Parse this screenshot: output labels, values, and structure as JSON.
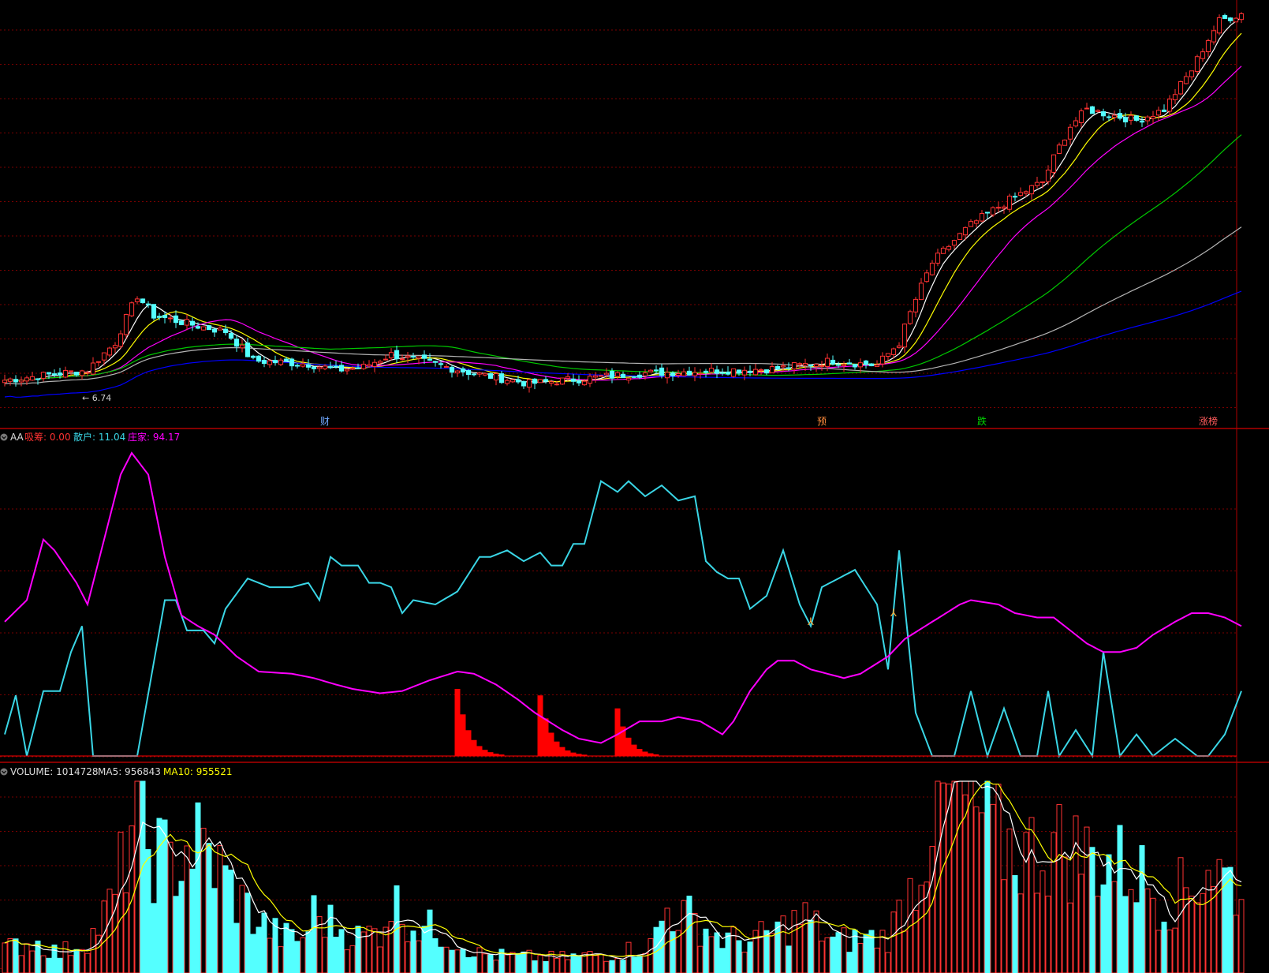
{
  "colors": {
    "background": "#000000",
    "grid": "#7a0000",
    "separator": "#b00000",
    "up": "#ff3232",
    "down": "#54ffff",
    "ma_white": "#ffffff",
    "ma_yellow": "#ffff00",
    "ma_magenta": "#ff00ff",
    "ma_green": "#00c800",
    "ma_gray": "#b4b4b4",
    "ma_blue": "#0000ff",
    "ind_cyan": "#3ad6e6",
    "ind_magenta": "#ff00ff",
    "ind_red": "#ff0000",
    "marker": "#ffaa33"
  },
  "price_panel": {
    "low_label": "6.74",
    "event_labels": [
      {
        "text": "财",
        "index": 58,
        "color": "#6fa8ff"
      },
      {
        "text": "预",
        "index": 148,
        "color": "#ff8c3c"
      },
      {
        "text": "跌",
        "index": 177,
        "color": "#00d200"
      },
      {
        "text": "涨榜",
        "index": 218,
        "color": "#ff5c5c"
      }
    ]
  },
  "indicator_panel": {
    "icon": "circle-chevron-icon",
    "name": "AA",
    "items": [
      {
        "label": "吸筹: 0.00",
        "color": "#ff3232"
      },
      {
        "label": "散户: 11.04",
        "color": "#3ad6e6"
      },
      {
        "label": "庄家: 94.17",
        "color": "#ff00ff"
      }
    ],
    "markers": [
      {
        "index": 146,
        "value": 62
      },
      {
        "index": 161,
        "value": 66
      }
    ]
  },
  "volume_panel": {
    "icon": "circle-chevron-icon",
    "items": [
      {
        "label": "VOLUME: 1014728",
        "color": "#dcdcdc"
      },
      {
        "label": "MA5: 956843",
        "color": "#dcdcdc"
      },
      {
        "label": "MA10: 955521",
        "color": "#ffff00"
      }
    ]
  },
  "chart_data": [
    {
      "type": "candlestick",
      "count": 225,
      "candle_keypoints": [
        [
          0,
          7.0
        ],
        [
          15,
          7.3
        ],
        [
          20,
          8.2
        ],
        [
          24,
          10.0
        ],
        [
          27,
          9.2
        ],
        [
          35,
          8.8
        ],
        [
          40,
          8.6
        ],
        [
          45,
          7.6
        ],
        [
          55,
          7.5
        ],
        [
          60,
          7.3
        ],
        [
          65,
          7.4
        ],
        [
          70,
          7.8
        ],
        [
          75,
          7.6
        ],
        [
          85,
          7.2
        ],
        [
          95,
          6.9
        ],
        [
          105,
          7.05
        ],
        [
          115,
          7.2
        ],
        [
          130,
          7.3
        ],
        [
          140,
          7.35
        ],
        [
          150,
          7.6
        ],
        [
          158,
          7.45
        ],
        [
          162,
          8.2
        ],
        [
          168,
          11.5
        ],
        [
          175,
          13.5
        ],
        [
          182,
          15.0
        ],
        [
          188,
          16.2
        ],
        [
          193,
          20.5
        ],
        [
          196,
          22.0
        ],
        [
          205,
          21.0
        ],
        [
          210,
          22.0
        ],
        [
          215,
          26.0
        ],
        [
          220,
          32.0
        ],
        [
          224,
          33.0
        ]
      ],
      "ma_windows": [
        5,
        10,
        20,
        60,
        120,
        250
      ]
    },
    {
      "type": "line",
      "series": [
        {
          "name": "散户",
          "keypoints": [
            [
              0,
              10
            ],
            [
              2,
              28
            ],
            [
              4,
              0
            ],
            [
              7,
              30
            ],
            [
              10,
              30
            ],
            [
              12,
              48
            ],
            [
              14,
              60
            ],
            [
              16,
              0
            ],
            [
              24,
              0
            ],
            [
              29,
              72
            ],
            [
              31,
              72
            ],
            [
              33,
              58
            ],
            [
              36,
              58
            ],
            [
              38,
              52
            ],
            [
              40,
              68
            ],
            [
              44,
              82
            ],
            [
              48,
              78
            ],
            [
              52,
              78
            ],
            [
              55,
              80
            ],
            [
              57,
              72
            ],
            [
              59,
              92
            ],
            [
              61,
              88
            ],
            [
              64,
              88
            ],
            [
              66,
              80
            ],
            [
              68,
              80
            ],
            [
              70,
              78
            ],
            [
              72,
              66
            ],
            [
              74,
              72
            ],
            [
              78,
              70
            ],
            [
              82,
              76
            ],
            [
              86,
              92
            ],
            [
              88,
              92
            ],
            [
              91,
              95
            ],
            [
              94,
              90
            ],
            [
              97,
              94
            ],
            [
              99,
              88
            ],
            [
              101,
              88
            ],
            [
              103,
              98
            ],
            [
              105,
              98
            ],
            [
              108,
              127
            ],
            [
              111,
              122
            ],
            [
              113,
              127
            ],
            [
              116,
              120
            ],
            [
              119,
              125
            ],
            [
              122,
              118
            ],
            [
              125,
              120
            ],
            [
              127,
              90
            ],
            [
              129,
              85
            ],
            [
              131,
              82
            ],
            [
              133,
              82
            ],
            [
              135,
              68
            ],
            [
              138,
              74
            ],
            [
              141,
              95
            ],
            [
              144,
              70
            ],
            [
              146,
              60
            ],
            [
              148,
              78
            ],
            [
              151,
              82
            ],
            [
              154,
              86
            ],
            [
              158,
              70
            ],
            [
              160,
              40
            ],
            [
              162,
              95
            ],
            [
              165,
              20
            ],
            [
              168,
              0
            ],
            [
              172,
              0
            ],
            [
              175,
              30
            ],
            [
              178,
              0
            ],
            [
              181,
              22
            ],
            [
              184,
              0
            ],
            [
              187,
              0
            ],
            [
              189,
              30
            ],
            [
              191,
              0
            ],
            [
              194,
              12
            ],
            [
              197,
              0
            ],
            [
              199,
              48
            ],
            [
              202,
              0
            ],
            [
              205,
              10
            ],
            [
              208,
              0
            ],
            [
              212,
              8
            ],
            [
              216,
              0
            ],
            [
              218,
              0
            ],
            [
              221,
              10
            ],
            [
              224,
              30
            ]
          ]
        },
        {
          "name": "庄家",
          "keypoints": [
            [
              0,
              62
            ],
            [
              4,
              72
            ],
            [
              7,
              100
            ],
            [
              9,
              95
            ],
            [
              13,
              80
            ],
            [
              15,
              70
            ],
            [
              18,
              100
            ],
            [
              21,
              130
            ],
            [
              23,
              140
            ],
            [
              26,
              130
            ],
            [
              29,
              92
            ],
            [
              32,
              65
            ],
            [
              35,
              60
            ],
            [
              38,
              56
            ],
            [
              42,
              46
            ],
            [
              46,
              39
            ],
            [
              52,
              38
            ],
            [
              56,
              36
            ],
            [
              60,
              33
            ],
            [
              63,
              31
            ],
            [
              68,
              29
            ],
            [
              72,
              30
            ],
            [
              77,
              35
            ],
            [
              82,
              39
            ],
            [
              85,
              38
            ],
            [
              89,
              33
            ],
            [
              93,
              26
            ],
            [
              96,
              20
            ],
            [
              101,
              12
            ],
            [
              104,
              8
            ],
            [
              108,
              6
            ],
            [
              111,
              10
            ],
            [
              115,
              16
            ],
            [
              119,
              16
            ],
            [
              122,
              18
            ],
            [
              126,
              16
            ],
            [
              130,
              10
            ],
            [
              132,
              16
            ],
            [
              135,
              30
            ],
            [
              138,
              40
            ],
            [
              140,
              44
            ],
            [
              143,
              44
            ],
            [
              146,
              40
            ],
            [
              149,
              38
            ],
            [
              152,
              36
            ],
            [
              155,
              38
            ],
            [
              160,
              46
            ],
            [
              163,
              54
            ],
            [
              168,
              62
            ],
            [
              173,
              70
            ],
            [
              175,
              72
            ],
            [
              180,
              70
            ],
            [
              183,
              66
            ],
            [
              187,
              64
            ],
            [
              190,
              64
            ],
            [
              193,
              58
            ],
            [
              196,
              52
            ],
            [
              199,
              48
            ],
            [
              202,
              48
            ],
            [
              205,
              50
            ],
            [
              208,
              56
            ],
            [
              212,
              62
            ],
            [
              215,
              66
            ],
            [
              218,
              66
            ],
            [
              221,
              64
            ],
            [
              224,
              60
            ]
          ]
        },
        {
          "name": "吸筹",
          "type": "bar",
          "blocks": [
            [
              82,
              31
            ],
            [
              97,
              28
            ],
            [
              111,
              22
            ]
          ]
        }
      ],
      "ylim": [
        0,
        140
      ]
    },
    {
      "type": "bar",
      "series": [
        {
          "name": "VOLUME"
        },
        {
          "name": "MA5"
        },
        {
          "name": "MA10"
        }
      ],
      "volume_keypoints": [
        [
          0,
          110
        ],
        [
          5,
          150
        ],
        [
          10,
          90
        ],
        [
          16,
          180
        ],
        [
          20,
          350
        ],
        [
          23,
          700
        ],
        [
          26,
          600
        ],
        [
          30,
          500
        ],
        [
          34,
          620
        ],
        [
          38,
          520
        ],
        [
          42,
          360
        ],
        [
          46,
          240
        ],
        [
          50,
          170
        ],
        [
          54,
          160
        ],
        [
          56,
          280
        ],
        [
          60,
          220
        ],
        [
          64,
          170
        ],
        [
          68,
          200
        ],
        [
          70,
          340
        ],
        [
          74,
          230
        ],
        [
          78,
          200
        ],
        [
          82,
          150
        ],
        [
          86,
          90
        ],
        [
          90,
          80
        ],
        [
          100,
          70
        ],
        [
          110,
          90
        ],
        [
          117,
          130
        ],
        [
          120,
          300
        ],
        [
          124,
          260
        ],
        [
          130,
          160
        ],
        [
          135,
          150
        ],
        [
          140,
          200
        ],
        [
          145,
          260
        ],
        [
          150,
          150
        ],
        [
          160,
          170
        ],
        [
          165,
          450
        ],
        [
          168,
          750
        ],
        [
          172,
          820
        ],
        [
          176,
          750
        ],
        [
          180,
          620
        ],
        [
          185,
          560
        ],
        [
          190,
          600
        ],
        [
          200,
          520
        ],
        [
          205,
          480
        ],
        [
          210,
          330
        ],
        [
          215,
          410
        ],
        [
          218,
          520
        ],
        [
          221,
          450
        ],
        [
          224,
          400
        ]
      ],
      "ylim": [
        0,
        900
      ]
    }
  ]
}
